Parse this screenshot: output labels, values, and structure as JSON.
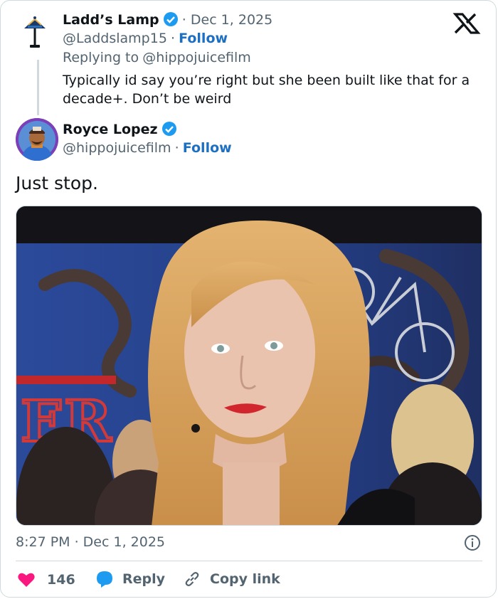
{
  "parent_tweet": {
    "author_name": "Ladd’s Lamp",
    "separator_date": "· Dec 1, 2025",
    "handle": "@Laddslamp15",
    "dot": "·",
    "follow_label": "Follow",
    "replying_prefix": "Replying to",
    "replying_handle": "@hippojuicefilm",
    "text_line1": "Typically id say you’re right but she been built like that for a",
    "text_line2": "decade+. Don’t be weird"
  },
  "main_tweet": {
    "author_name": "Royce Lopez",
    "handle": "@hippojuicefilm",
    "dot": "·",
    "follow_label": "Follow",
    "text": "Just stop.",
    "timestamp": "8:27 PM · Dec 1, 2025"
  },
  "actions": {
    "like_count": "146",
    "reply_label": "Reply",
    "copy_link_label": "Copy link"
  },
  "colors": {
    "accent": "#1d9bf0",
    "link": "#1d6fc2",
    "like": "#f91880",
    "muted": "#536471"
  },
  "icons": [
    "lamp-avatar-icon",
    "verified-icon",
    "x-logo-icon",
    "info-icon",
    "heart-icon",
    "reply-icon",
    "link-icon"
  ]
}
